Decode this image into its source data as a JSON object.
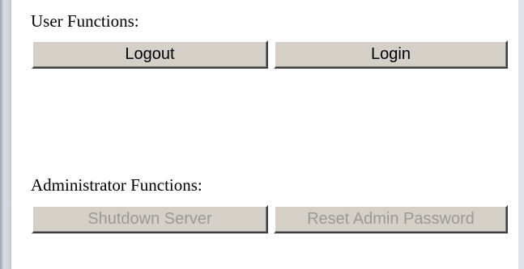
{
  "user_functions": {
    "heading": "User Functions:",
    "logout_label": "Logout",
    "login_label": "Login"
  },
  "admin_functions": {
    "heading": "Administrator Functions:",
    "shutdown_label": "Shutdown Server",
    "reset_password_label": "Reset Admin Password",
    "buttons_enabled": false
  }
}
